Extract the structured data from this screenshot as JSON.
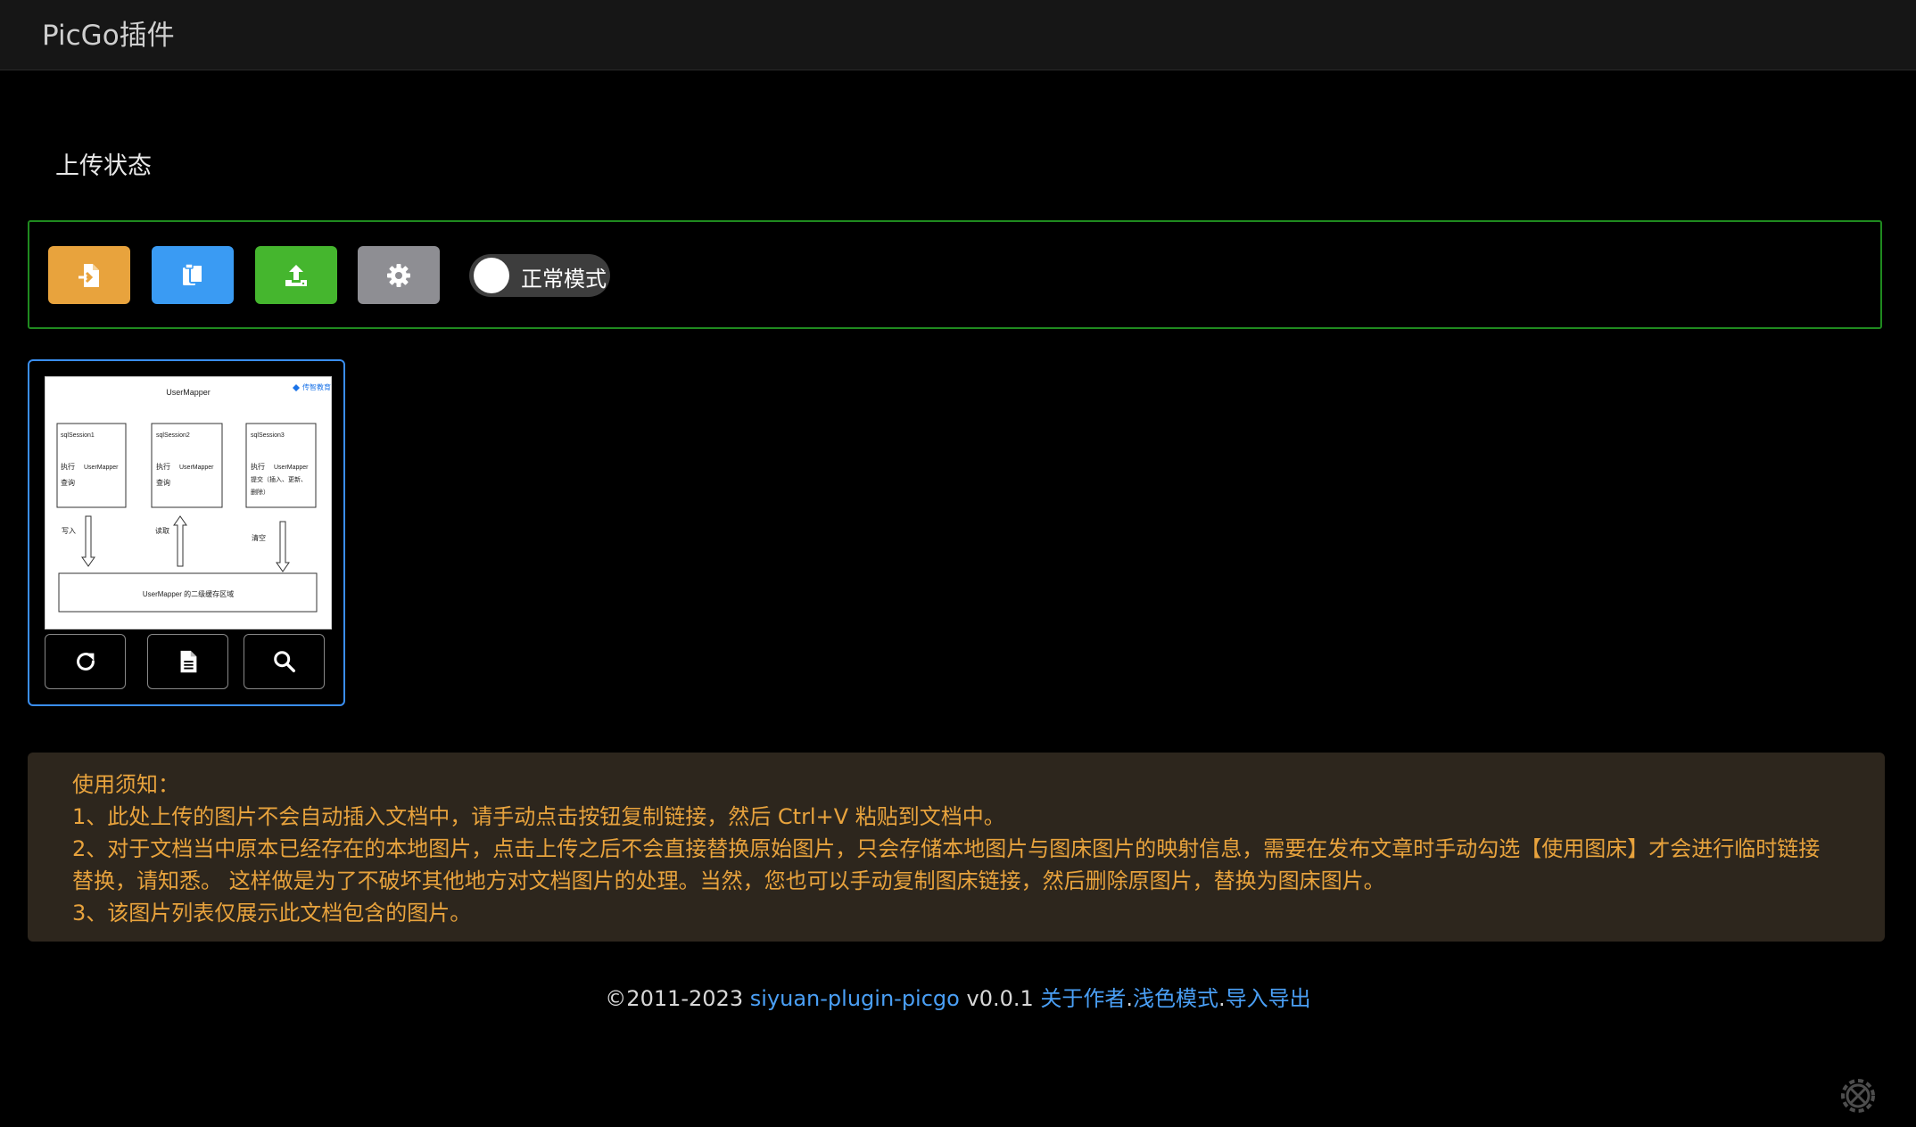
{
  "app": {
    "title": "PicGo插件"
  },
  "section": {
    "title": "上传状态"
  },
  "toolbar": {
    "mode_label": "正常模式",
    "buttons": [
      {
        "icon": "file-import-icon",
        "color": "#e8a33d"
      },
      {
        "icon": "copy-icon",
        "color": "#3a9bf3"
      },
      {
        "icon": "upload-icon",
        "color": "#45b62e"
      },
      {
        "icon": "gear-icon",
        "color": "#8e8e93"
      }
    ]
  },
  "image_card": {
    "thumbnail": {
      "title": "UserMapper",
      "logo_text": "传智教育",
      "sessions": [
        {
          "name": "sqlSession1",
          "line1": "执行",
          "line1b": "UserMapper",
          "line2": "查询"
        },
        {
          "name": "sqlSession2",
          "line1": "执行",
          "line1b": "UserMapper",
          "line2": "查询"
        },
        {
          "name": "sqlSession3",
          "line1": "执行",
          "line1b": "UserMapper",
          "line2": "提交（插入、更新、",
          "line3": "删除）"
        }
      ],
      "arrow_labels": [
        "写入",
        "读取",
        "清空"
      ],
      "bottom_box": "UserMapper 的二级缓存区域"
    },
    "actions": [
      "refresh-icon",
      "document-icon",
      "search-icon"
    ]
  },
  "notice": {
    "heading": "使用须知：",
    "lines": [
      "1、此处上传的图片不会自动插入文档中，请手动点击按钮复制链接，然后 Ctrl+V 粘贴到文档中。",
      "2、对于文档当中原本已经存在的本地图片，点击上传之后不会直接替换原始图片，只会存储本地图片与图床图片的映射信息，需要在发布文章时手动勾选【使用图床】才会进行临时链接替换，请知悉。 这样做是为了不破坏其他地方对文档图片的处理。当然，您也可以手动复制图床链接，然后删除原图片，替换为图床图片。",
      "3、该图片列表仅展示此文档包含的图片。"
    ]
  },
  "footer": {
    "copyright": "©2011-2023",
    "project_link": "siyuan-plugin-picgo",
    "version": "v0.0.1",
    "about_link": "关于作者",
    "sep1": ".",
    "theme_link": "浅色模式",
    "sep2": ".",
    "import_export_link": "导入导出"
  },
  "colors": {
    "background": "#000000",
    "accent_link": "#4a9ff5",
    "notice_text": "#e8a33d",
    "toolbar_border": "#1f8a1f",
    "card_border": "#3a8ef0"
  }
}
